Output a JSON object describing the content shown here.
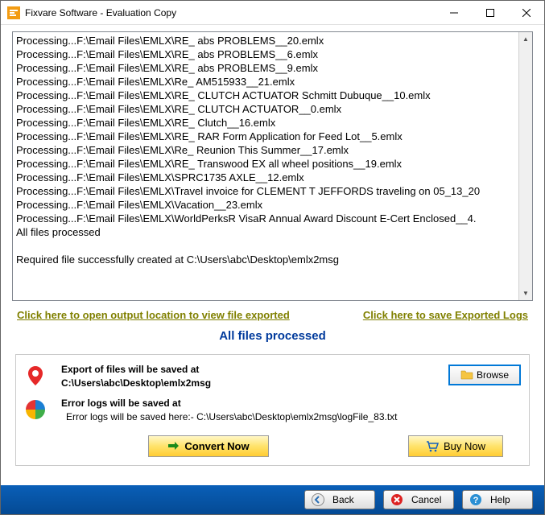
{
  "window": {
    "title": "Fixvare Software - Evaluation Copy"
  },
  "log_lines": [
    "Processing...F:\\Email Files\\EMLX\\RE_ abs PROBLEMS__20.emlx",
    "Processing...F:\\Email Files\\EMLX\\RE_ abs PROBLEMS__6.emlx",
    "Processing...F:\\Email Files\\EMLX\\RE_ abs PROBLEMS__9.emlx",
    "Processing...F:\\Email Files\\EMLX\\Re_ AM515933__21.emlx",
    "Processing...F:\\Email Files\\EMLX\\RE_ CLUTCH ACTUATOR Schmitt Dubuque__10.emlx",
    "Processing...F:\\Email Files\\EMLX\\RE_ CLUTCH ACTUATOR__0.emlx",
    "Processing...F:\\Email Files\\EMLX\\RE_ Clutch__16.emlx",
    "Processing...F:\\Email Files\\EMLX\\RE_ RAR Form Application for Feed Lot__5.emlx",
    "Processing...F:\\Email Files\\EMLX\\Re_ Reunion This Summer__17.emlx",
    "Processing...F:\\Email Files\\EMLX\\RE_ Transwood EX all wheel positions__19.emlx",
    "Processing...F:\\Email Files\\EMLX\\SPRC1735 AXLE__12.emlx",
    "Processing...F:\\Email Files\\EMLX\\Travel invoice for CLEMENT T JEFFORDS traveling on 05_13_20",
    "Processing...F:\\Email Files\\EMLX\\Vacation__23.emlx",
    "Processing...F:\\Email Files\\EMLX\\WorldPerksR VisaR Annual Award Discount E-Cert Enclosed__4.",
    "All files processed",
    "",
    "Required file successfully created at C:\\Users\\abc\\Desktop\\emlx2msg"
  ],
  "links": {
    "open_output": "Click here to open output location to view file exported",
    "save_logs": "Click here to save Exported Logs"
  },
  "status": "All files processed",
  "export": {
    "label": "Export of files will be saved at",
    "path": "C:\\Users\\abc\\Desktop\\emlx2msg",
    "browse": "Browse"
  },
  "errorlog": {
    "label": "Error logs will be saved at",
    "path": "Error logs will be saved here:- C:\\Users\\abc\\Desktop\\emlx2msg\\logFile_83.txt"
  },
  "buttons": {
    "convert": "Convert Now",
    "buy": "Buy Now",
    "back": "Back",
    "cancel": "Cancel",
    "help": "Help"
  }
}
